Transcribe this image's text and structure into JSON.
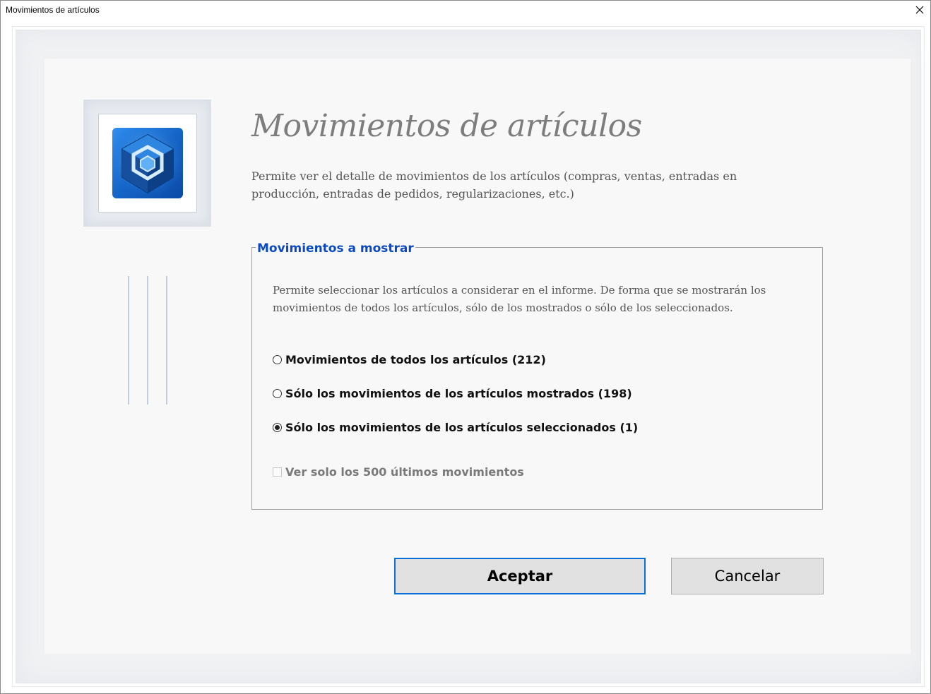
{
  "window": {
    "title": "Movimientos de artículos"
  },
  "header": {
    "heading": "Movimientos de artículos",
    "description": "Permite ver el detalle de movimientos de los artículos (compras, ventas, entradas en producción, entradas de pedidos, regularizaciones, etc.)"
  },
  "group": {
    "legend": "Movimientos a mostrar",
    "description": "Permite seleccionar los artículos a considerar en el informe. De forma que se mostrarán los movimientos de todos los artículos, sólo de los mostrados o sólo de los seleccionados.",
    "options": [
      {
        "label": "Movimientos de todos los artículos (212)",
        "checked": false
      },
      {
        "label": "Sólo los movimientos de los artículos mostrados (198)",
        "checked": false
      },
      {
        "label": "Sólo los movimientos de los artículos seleccionados (1)",
        "checked": true
      }
    ],
    "limit_checkbox": {
      "label": "Ver solo los 500 últimos movimientos",
      "checked": false,
      "enabled": false
    }
  },
  "buttons": {
    "accept": "Aceptar",
    "cancel": "Cancelar"
  },
  "colors": {
    "legend": "#0b49c4",
    "accept_border": "#0a6fd8",
    "icon_blue": "#1e73d6"
  },
  "icons": {
    "close": "close-icon",
    "app": "cube-icon"
  }
}
